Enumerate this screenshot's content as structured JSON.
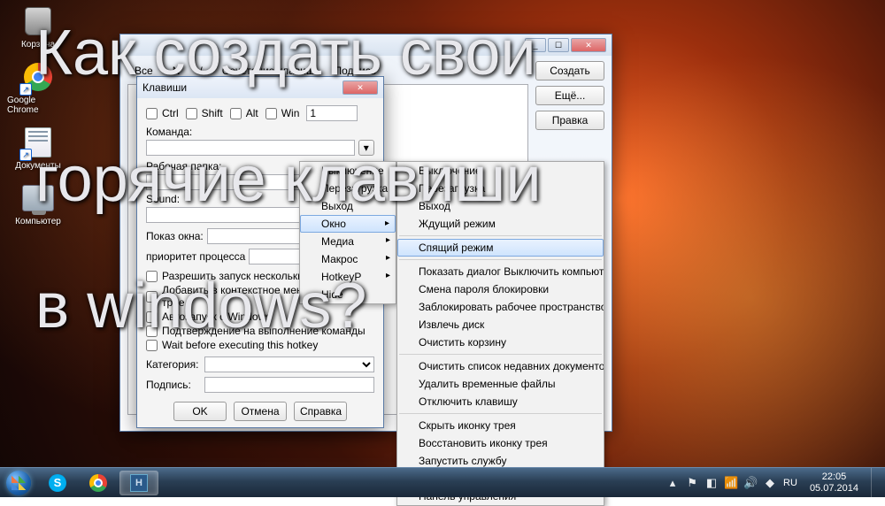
{
  "overlay": {
    "line1": "Как создать свои",
    "line2": "горячие клавиши",
    "line3": "в windows?"
  },
  "desktop_icons": {
    "trash": "Корзина",
    "chrome": "Google Chrome",
    "documents": "Документы",
    "computer": "Компьютер"
  },
  "main_window": {
    "tabs": {
      "all": "Все",
      "n": "N",
      "slash": "/",
      "combo": "Сочетание клавиш",
      "sub": "Подпись"
    },
    "buttons": {
      "create": "Создать",
      "more": "Ещё...",
      "edit": "Правка"
    }
  },
  "keys_dialog": {
    "title": "Клавиши",
    "mods": {
      "ctrl": "Ctrl",
      "shift": "Shift",
      "alt": "Alt",
      "win": "Win"
    },
    "key_value": "1",
    "labels": {
      "command": "Команда:",
      "workdir": "Рабочая папка:",
      "sound": "Sound:",
      "window": "Показ окна:",
      "prio": "приоритет процесса",
      "category": "Категория:",
      "caption": "Подпись:"
    },
    "checks": {
      "multi": "Разрешить запуск нескольких экземпл...",
      "tray": "Добавить в контекстное меню значка в трее",
      "autorun": "Автозапуск с Windows",
      "confirm": "Подтверждение на выполнение команды",
      "wait": "Wait before executing this hotkey"
    },
    "buttons": {
      "ok": "OK",
      "cancel": "Отмена",
      "help": "Справка"
    }
  },
  "menu1": [
    {
      "label": "Выключение",
      "sub": false
    },
    {
      "label": "Перезагрузка",
      "sub": false
    },
    {
      "label": "Выход",
      "sub": false
    },
    {
      "label": "Окно",
      "sub": true,
      "hl": true
    },
    {
      "label": "Медиа",
      "sub": true
    },
    {
      "label": "Макрос",
      "sub": true
    },
    {
      "label": "HotkeyP",
      "sub": true
    },
    {
      "label": "Hide",
      "sub": false
    }
  ],
  "menu2_groups": [
    [
      "Выключение",
      "Перезагрузка",
      "Выход",
      "Ждущий режим"
    ],
    [
      "Спящий режим"
    ],
    [
      "Показать диалог Выключить компьютер",
      "Смена пароля блокировки",
      "Заблокировать рабочее пространство",
      "Извлечь диск",
      "Очистить корзину"
    ],
    [
      "Очистить список недавних документов",
      "Удалить временные файлы",
      "Отключить клавишу"
    ],
    [
      "Скрыть иконку трея",
      "Восстановить иконку трея",
      "Запустить службу",
      "Остановить службу",
      "Панель управления"
    ]
  ],
  "taskbar": {
    "time": "22:05",
    "date": "05.07.2014",
    "lang": "RU"
  }
}
